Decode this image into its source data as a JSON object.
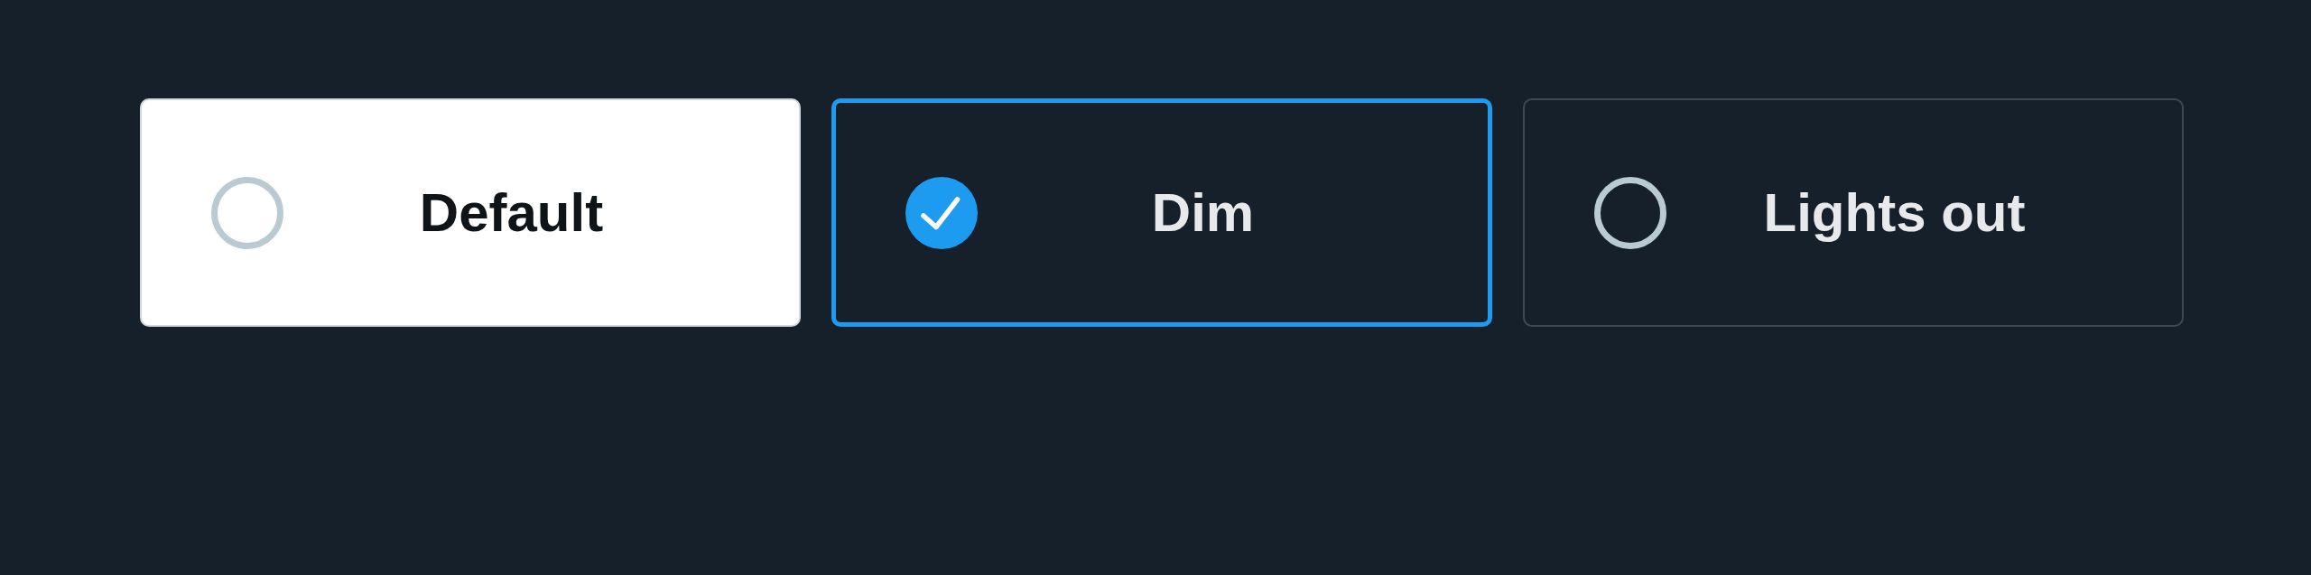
{
  "options": [
    {
      "label": "Default",
      "kind": "light",
      "selected": false
    },
    {
      "label": "Dim",
      "kind": "dark",
      "selected": true
    },
    {
      "label": "Lights out",
      "kind": "dark",
      "selected": false
    }
  ]
}
